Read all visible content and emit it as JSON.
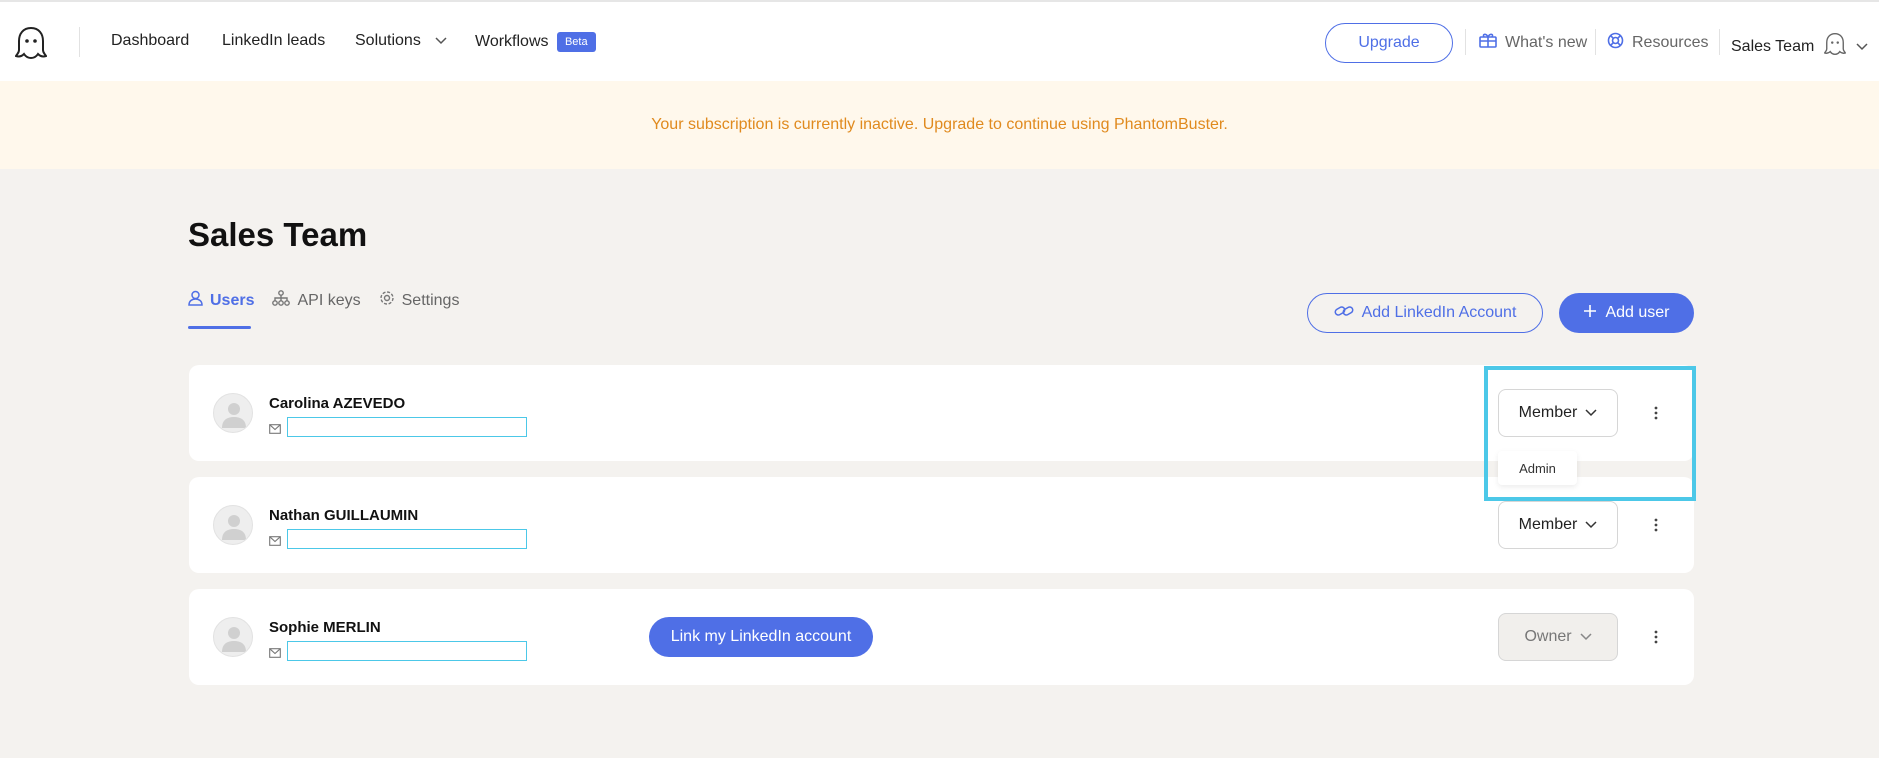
{
  "nav": {
    "links": [
      {
        "label": "Dashboard"
      },
      {
        "label": "LinkedIn leads"
      },
      {
        "label": "Solutions"
      },
      {
        "label": "Workflows"
      }
    ],
    "beta_badge": "Beta",
    "upgrade_label": "Upgrade",
    "whats_new": "What's new",
    "resources": "Resources",
    "team_name": "Sales Team"
  },
  "banner": {
    "message": "Your subscription is currently inactive. Upgrade to continue using PhantomBuster."
  },
  "page": {
    "title": "Sales Team",
    "tabs": [
      {
        "label": "Users",
        "icon": "user-icon",
        "active": true
      },
      {
        "label": "API keys",
        "icon": "api-keys-icon",
        "active": false
      },
      {
        "label": "Settings",
        "icon": "gear-icon",
        "active": false
      }
    ],
    "add_linkedin_label": "Add LinkedIn Account",
    "add_user_label": "Add user"
  },
  "users": [
    {
      "name": "Carolina AZEVEDO",
      "role": "Member"
    },
    {
      "name": "Nathan GUILLAUMIN",
      "role": "Member"
    },
    {
      "name": "Sophie MERLIN",
      "role": "Owner",
      "link_label": "Link my LinkedIn account"
    }
  ],
  "role_dropdown": {
    "options": [
      "Admin"
    ]
  },
  "colors": {
    "accent": "#4f6fe6",
    "warning_text": "#e08a1e",
    "warning_bg": "#fff8ec",
    "highlight": "#4cc8e8"
  }
}
